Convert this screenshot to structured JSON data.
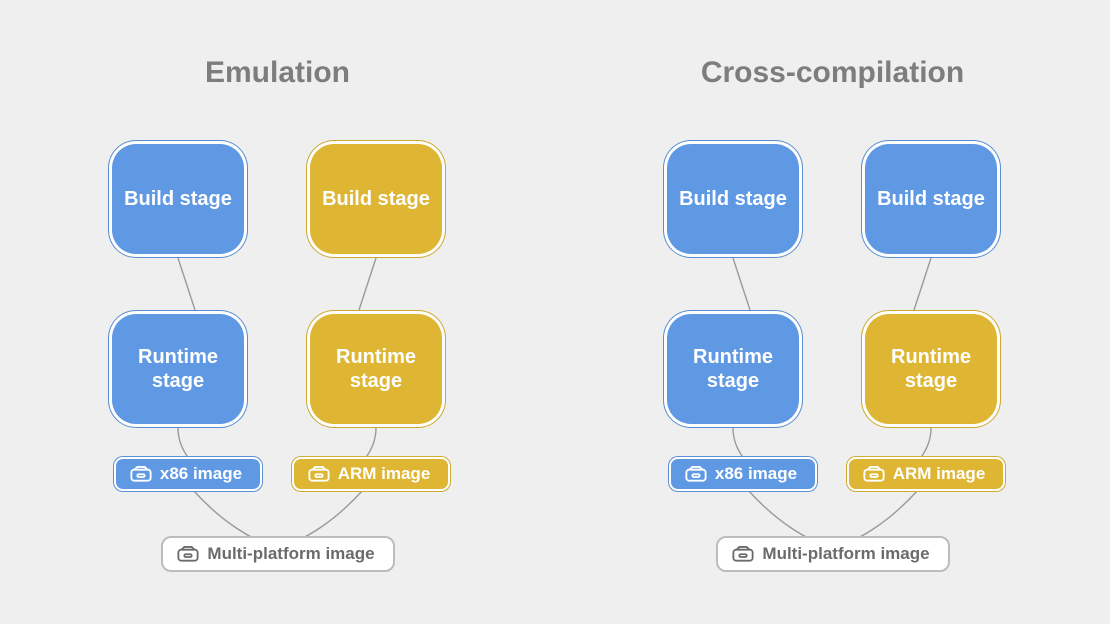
{
  "diagram": {
    "left": {
      "title": "Emulation",
      "build_left": "Build stage",
      "build_right": "Build stage",
      "runtime_left": "Runtime stage",
      "runtime_right": "Runtime stage",
      "image_left": "x86 image",
      "image_right": "ARM image",
      "multi": "Multi-platform image",
      "colors": {
        "left_col": "blue",
        "right_col": "yellow"
      }
    },
    "right": {
      "title": "Cross-compilation",
      "build_left": "Build stage",
      "build_right": "Build stage",
      "runtime_left": "Runtime stage",
      "runtime_right": "Runtime stage",
      "image_left": "x86 image",
      "image_right": "ARM image",
      "multi": "Multi-platform image",
      "colors": {
        "build_right": "blue",
        "runtime_right": "yellow"
      }
    }
  }
}
